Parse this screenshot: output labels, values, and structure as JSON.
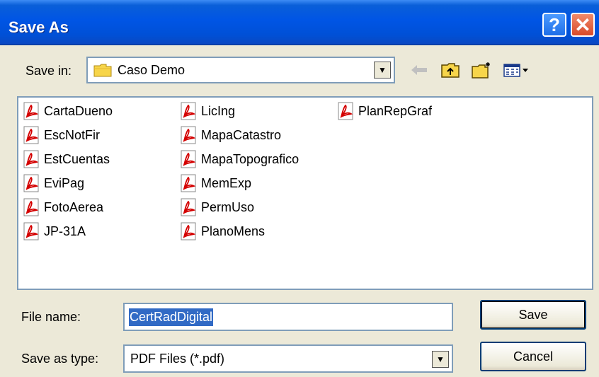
{
  "window": {
    "title": "Save As",
    "help_glyph": "?",
    "close_glyph": "✕"
  },
  "save_in": {
    "label": "Save in:",
    "value": "Caso Demo",
    "icon": "folder-icon"
  },
  "toolbar": {
    "icons": [
      "back-arrow-icon",
      "up-folder-icon",
      "new-folder-icon",
      "view-menu-icon"
    ]
  },
  "files": [
    "CartaDueno",
    "EscNotFir",
    "EstCuentas",
    "EviPag",
    "FotoAerea",
    "JP-31A",
    "LicIng",
    "MapaCatastro",
    "MapaTopografico",
    "MemExp",
    "PermUso",
    "PlanoMens",
    "PlanRepGraf"
  ],
  "file_name": {
    "label": "File name:",
    "value": "CertRadDigital"
  },
  "save_type": {
    "label": "Save as type:",
    "value": "PDF Files (*.pdf)"
  },
  "buttons": {
    "save": "Save",
    "cancel": "Cancel"
  },
  "colors": {
    "titlebar": "#0055e5",
    "selection": "#316ac5",
    "pdf_red": "#d40000"
  }
}
